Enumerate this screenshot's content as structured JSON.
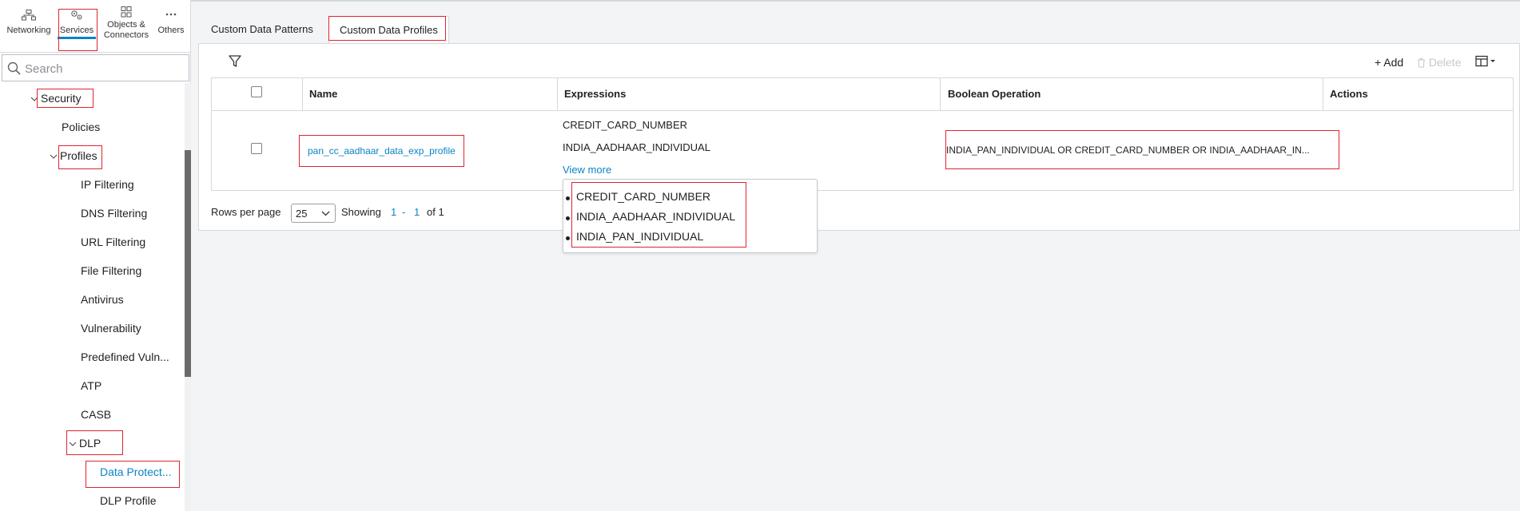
{
  "left_nav": {
    "tabs": [
      {
        "label": "Networking",
        "icon": "network-icon"
      },
      {
        "label": "Services",
        "icon": "services-icon",
        "active": true
      },
      {
        "label_line1": "Objects &",
        "label_line2": "Connectors",
        "icon": "objects-icon"
      },
      {
        "label": "Others",
        "icon": "more-icon"
      }
    ],
    "search_placeholder": "Search",
    "tree": {
      "security": "Security",
      "policies": "Policies",
      "profiles": "Profiles",
      "ip_filtering": "IP Filtering",
      "dns_filtering": "DNS Filtering",
      "url_filtering": "URL Filtering",
      "file_filtering": "File Filtering",
      "antivirus": "Antivirus",
      "vulnerability": "Vulnerability",
      "predefined_vuln": "Predefined Vuln...",
      "atp": "ATP",
      "casb": "CASB",
      "dlp": "DLP",
      "data_protect": "Data Protect...",
      "dlp_profile": "DLP Profile"
    }
  },
  "main": {
    "tabs": [
      "Custom Data Patterns",
      "Custom Data Profiles"
    ],
    "toolbar": {
      "add_label": "+ Add",
      "delete_label": "Delete"
    },
    "columns": [
      "Name",
      "Expressions",
      "Boolean Operation",
      "Actions"
    ],
    "row": {
      "name": "pan_cc_aadhaar_data_exp_profile",
      "expressions": [
        "CREDIT_CARD_NUMBER",
        "INDIA_AADHAAR_INDIVIDUAL"
      ],
      "view_more": "View more",
      "boolean_operation": "INDIA_PAN_INDIVIDUAL OR CREDIT_CARD_NUMBER OR INDIA_AADHAAR_IN..."
    },
    "footer": {
      "rows_per_page_label": "Rows per page",
      "rows_per_page_value": "25",
      "showing_label": "Showing",
      "range_start": "1",
      "range_sep": "-",
      "range_end": "1",
      "of_label": "of 1"
    },
    "popover_items": [
      "CREDIT_CARD_NUMBER",
      "INDIA_AADHAAR_INDIVIDUAL",
      "INDIA_PAN_INDIVIDUAL"
    ]
  },
  "colors": {
    "accent": "#0a84c6",
    "highlight": "#e0242f"
  }
}
